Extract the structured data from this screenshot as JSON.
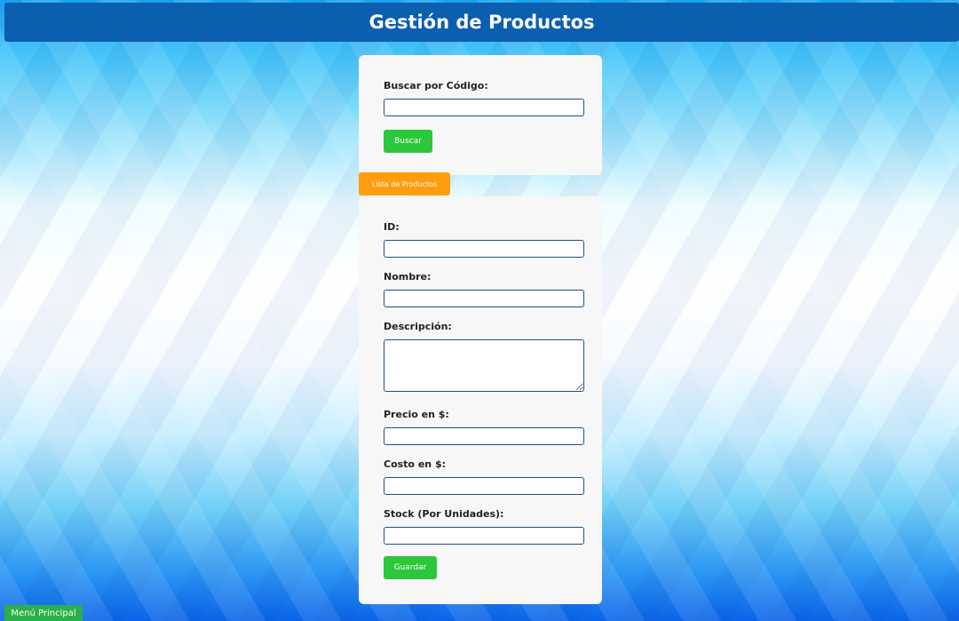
{
  "header": {
    "title": "Gestión de Productos"
  },
  "search": {
    "label": "Buscar por Código:",
    "value": "",
    "button_label": "Buscar"
  },
  "tab": {
    "label": "Lista de Productos"
  },
  "form": {
    "id_label": "ID:",
    "nombre_label": "Nombre:",
    "descripcion_label": "Descripción:",
    "precio_label": "Precio en $:",
    "costo_label": "Costo en $:",
    "stock_label": "Stock (Por Unidades):",
    "save_label": "Guardar"
  },
  "footer": {
    "menu_label": "Menú Principal"
  },
  "colors": {
    "header_bg": "#0c5eae",
    "accent_green": "#2ac83a",
    "accent_orange": "#ff9d0f",
    "field_border": "#1a4f8b"
  }
}
